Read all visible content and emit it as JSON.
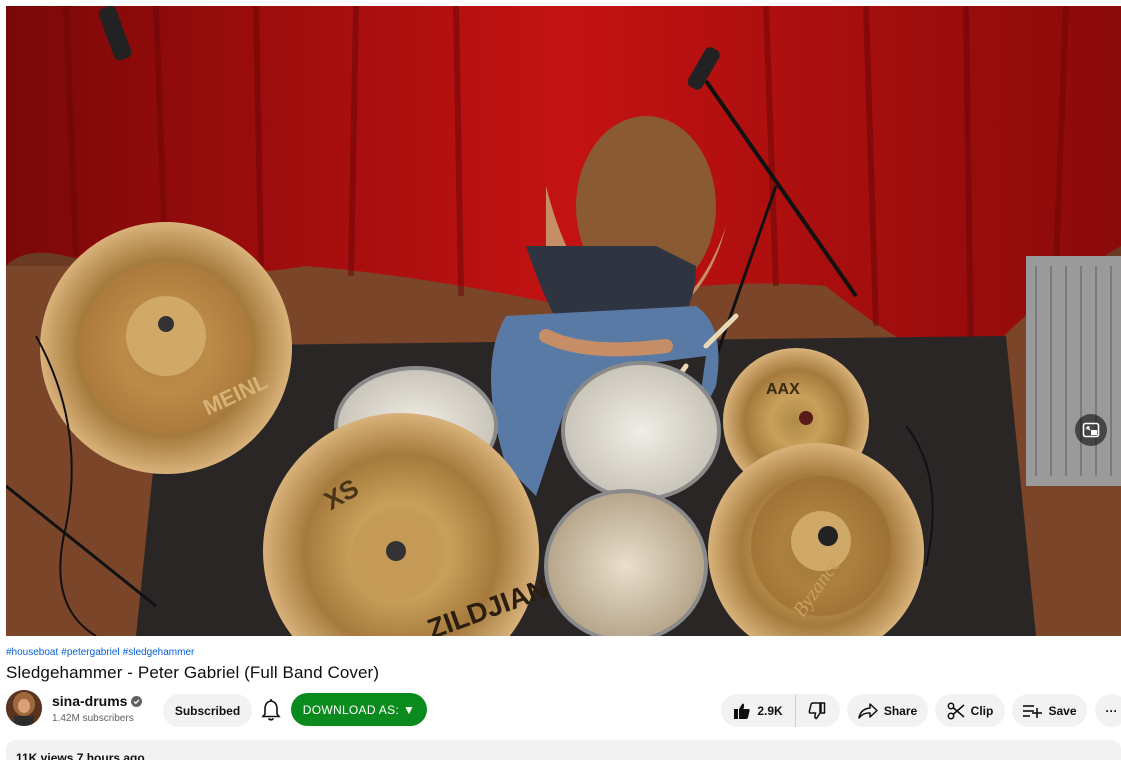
{
  "video": {
    "hashtags": [
      "#houseboat",
      "#petergabriel",
      "#sledgehammer"
    ],
    "title": "Sledgehammer - Peter Gabriel (Full Band Cover)",
    "cymbal_text": {
      "left_top": "MEINL",
      "xs": "XS",
      "zildjian": "ZILDJIAN",
      "aax": "AAX",
      "byzance": "Byzance"
    }
  },
  "channel": {
    "name": "sina-drums",
    "subscribers": "1.42M subscribers"
  },
  "actions": {
    "subscribed_label": "Subscribed",
    "download_label": "DOWNLOAD AS:",
    "download_arrow": "▼",
    "like_count": "2.9K",
    "share_label": "Share",
    "clip_label": "Clip",
    "save_label": "Save",
    "more_glyph": "···"
  },
  "description": {
    "meta": "11K views  7 hours ago"
  },
  "colors": {
    "download_green": "#0b8b1e",
    "link_blue": "#065fd4",
    "pill_bg": "#f2f2f2"
  },
  "icons": {
    "bell": "bell-icon",
    "like": "thumbs-up-icon",
    "dislike": "thumbs-down-icon",
    "share": "share-arrow-icon",
    "clip": "scissors-icon",
    "save": "playlist-add-icon",
    "miniplayer": "miniplayer-icon"
  }
}
